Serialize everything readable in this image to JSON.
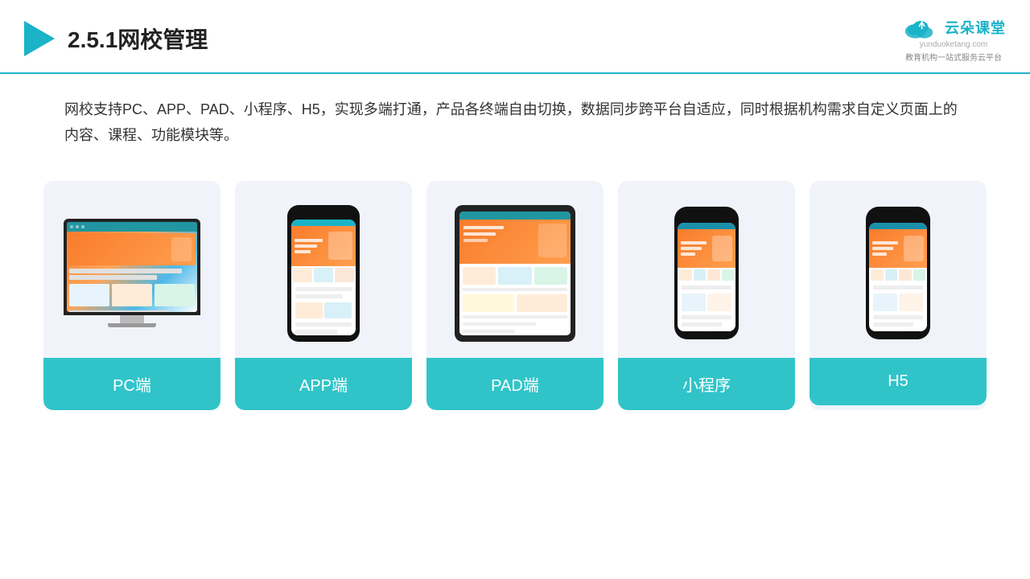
{
  "header": {
    "title": "2.5.1网校管理",
    "logo_name": "云朵课堂",
    "logo_url": "yunduoketang.com",
    "logo_sub": "教育机构一站式服务云平台"
  },
  "description": {
    "text": "网校支持PC、APP、PAD、小程序、H5，实现多端打通，产品各终端自由切换，数据同步跨平台自适应，同时根据机构需求自定义页面上的内容、课程、功能模块等。"
  },
  "cards": [
    {
      "id": "pc",
      "label": "PC端"
    },
    {
      "id": "app",
      "label": "APP端"
    },
    {
      "id": "pad",
      "label": "PAD端"
    },
    {
      "id": "miniprogram",
      "label": "小程序"
    },
    {
      "id": "h5",
      "label": "H5"
    }
  ]
}
